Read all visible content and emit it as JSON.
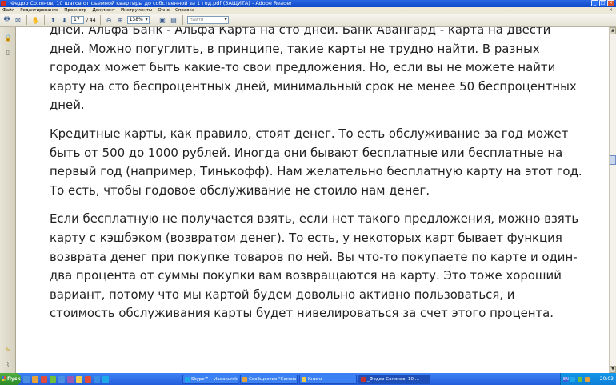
{
  "window": {
    "title": "_Федор Солянов, 10 шагов от съемной квартиры до  собственной за 1 год.pdf (ЗАЩИТА) - Adobe Reader"
  },
  "menu": {
    "items": [
      "Файл",
      "Редактирование",
      "Просмотр",
      "Документ",
      "Инструменты",
      "Окно",
      "Справка"
    ]
  },
  "toolbar": {
    "page_current": "17",
    "page_total": "/ 44",
    "zoom": "138%",
    "find_placeholder": "Найти"
  },
  "document": {
    "paragraphs": [
      {
        "lines": [
          "дней. Альфа Банк - Альфа Карта на сто дней. Банк Авангард - карта на двести",
          "дней. Можно погуглить, в принципе, такие карты не трудно найти. В разных",
          "городах может быть какие-то свои предложения.  Но, если вы не можете найти",
          "карту на сто беспроцентных дней, минимальный срок не менее 50 беспроцентных",
          "дней."
        ]
      },
      {
        "lines": [
          "Кредитные карты, как правило,  стоят денег. То есть обслуживание за год может",
          "быть от 500 до 1000 рублей. Иногда они бывают бесплатные или бесплатные на",
          "первый год (например, Тинькофф). Нам желательно бесплатную карту на этот год.",
          "То есть, чтобы годовое обслуживание не стоило нам денег."
        ]
      },
      {
        "lines": [
          "Если бесплатную не получается взять, если нет такого предложения, можно взять",
          "карту с кэшбэком (возвратом денег). То есть, у некоторых карт бывает функция",
          "возврата денег при покупке товаров по ней. Вы что-то покупаете по карте и один-",
          "два процента от суммы покупки вам возвращаются на карту. Это тоже хороший",
          "вариант,  потому что мы картой будем довольно активно пользоваться, и",
          "стоимость обслуживания карты будет нивелироваться за счет этого процента."
        ]
      }
    ]
  },
  "taskbar": {
    "start_label": "Пуск",
    "tasks": [
      {
        "label": "Skype™ - vladakurski1974",
        "icon_color": "#1ea8e8"
      },
      {
        "label": "Сообщество \"Семейны...",
        "icon_color": "#e8a23a"
      },
      {
        "label": "Книги",
        "icon_color": "#f2cc4a"
      },
      {
        "label": "_Федор Солянов, 10 ...",
        "icon_color": "#c9302c"
      }
    ],
    "lang": "EN",
    "clock": "20:03"
  }
}
